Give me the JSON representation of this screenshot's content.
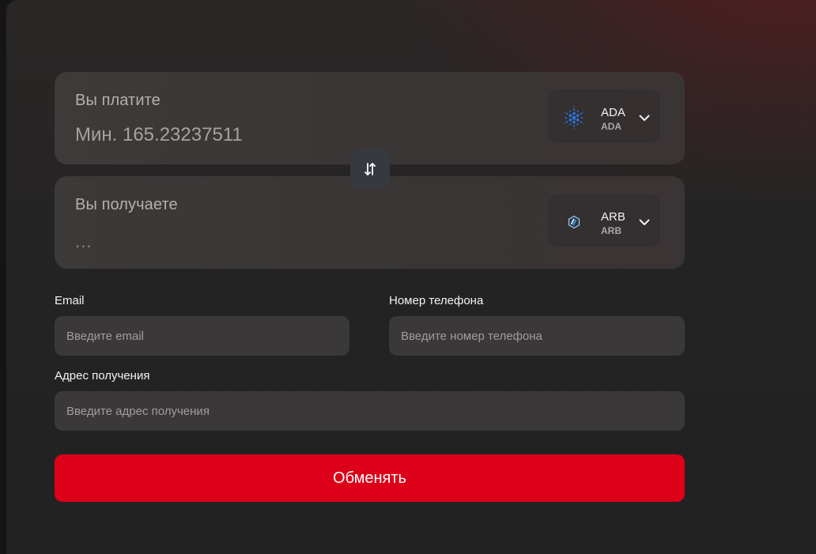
{
  "exchange": {
    "pay": {
      "label": "Вы платите",
      "amount_placeholder": "Мин. 165.23237511",
      "token": {
        "symbol": "ADA",
        "network": "ADA",
        "icon": "cardano-icon",
        "color": "#2a6fdb"
      }
    },
    "receive": {
      "label": "Вы получаете",
      "amount": "...",
      "token": {
        "symbol": "ARB",
        "network": "ARB",
        "icon": "arbitrum-icon",
        "color": "#2d374b"
      }
    },
    "swap_icon": "swap-arrows-icon"
  },
  "form": {
    "email": {
      "label": "Email",
      "placeholder": "Введите email"
    },
    "phone": {
      "label": "Номер телефона",
      "placeholder": "Введите номер телефона"
    },
    "address": {
      "label": "Адрес получения",
      "placeholder": "Введите адрес получения"
    },
    "submit_label": "Обменять"
  },
  "colors": {
    "accent": "#dd0019",
    "card_bg": "#3c3838",
    "field_bg": "#3a3838"
  }
}
